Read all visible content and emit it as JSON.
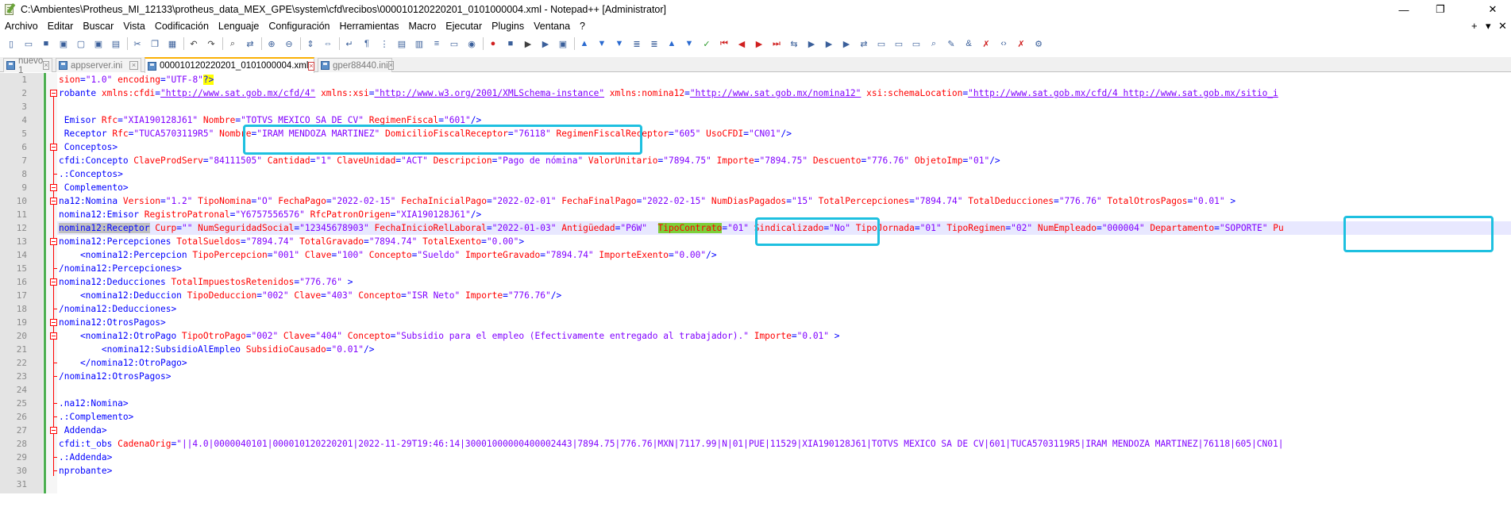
{
  "window": {
    "title": "C:\\Ambientes\\Protheus_MI_12133\\protheus_data_MEX_GPE\\system\\cfd\\recibos\\000010120220201_0101000004.xml - Notepad++ [Administrator]",
    "minimize": "—",
    "restore": "❐",
    "close": "✕"
  },
  "menu": {
    "items": [
      "Archivo",
      "Editar",
      "Buscar",
      "Vista",
      "Codificación",
      "Lenguaje",
      "Configuración",
      "Herramientas",
      "Macro",
      "Ejecutar",
      "Plugins",
      "Ventana",
      "?"
    ],
    "plus": "+",
    "chevron": "▾",
    "close_x": "✕"
  },
  "toolbar": {
    "icons": [
      "new-icon",
      "open-icon",
      "save-icon",
      "save-all-icon",
      "close-icon",
      "close-all-icon",
      "print-icon",
      "cut-icon",
      "copy-icon",
      "paste-icon",
      "undo-icon",
      "redo-icon",
      "find-icon",
      "replace-icon",
      "zoom-in-icon",
      "zoom-out-icon",
      "sync-v-icon",
      "sync-h-icon",
      "wrap-icon",
      "all-chars-icon",
      "indent-guide-icon",
      "udl-icon",
      "doc-map-icon",
      "function-list-icon",
      "folder-workspace-icon",
      "monitor-icon",
      "record-icon",
      "stop-icon",
      "play-icon",
      "run-multiple-icon",
      "save-macro-icon",
      "xml-tools-icon",
      "compare-icon",
      "bookmark-icon",
      "indent-icon",
      "unindent-icon",
      "sort-up-icon",
      "sort-down-icon",
      "check-icon",
      "nav-first-icon",
      "nav-prev-icon",
      "nav-next-icon",
      "nav-last-icon",
      "diff-icon",
      "plugin-a-icon",
      "plugin-b-icon",
      "plugin-c-icon",
      "plugin-d-icon",
      "plugin-e-icon",
      "plugin-f-icon",
      "plugin-g-icon",
      "plugin-h-icon",
      "plugin-i-icon",
      "amp-icon",
      "no-amp-icon",
      "tag-icon",
      "tag-no-icon",
      "settings-icon"
    ]
  },
  "tabs": [
    {
      "label": "nuevo 1",
      "active": false
    },
    {
      "label": "appserver.ini",
      "active": false
    },
    {
      "label": "000010120220201_0101000004.xml",
      "active": true
    },
    {
      "label": "gper88440.ini",
      "active": false
    }
  ],
  "editor": {
    "line_numbers": [
      "1",
      "2",
      "3",
      "4",
      "5",
      "6",
      "7",
      "8",
      "9",
      "10",
      "11",
      "12",
      "13",
      "14",
      "15",
      "16",
      "17",
      "18",
      "19",
      "20",
      "21",
      "22",
      "23",
      "24",
      "25",
      "26",
      "27",
      "28",
      "29",
      "30",
      "31"
    ],
    "current_line": 12,
    "lines": [
      [
        [
          "at",
          "sion"
        ],
        [
          "tg",
          "="
        ],
        [
          "vl",
          "\"1.0\""
        ],
        [
          "at",
          " encoding"
        ],
        [
          "tg",
          "="
        ],
        [
          "vl",
          "\"UTF-8\""
        ],
        [
          "hl",
          "?>"
        ]
      ],
      [
        [
          "tg",
          "robante "
        ],
        [
          "at",
          "xmlns:cfdi"
        ],
        [
          "tg",
          "="
        ],
        [
          "vlu",
          "\"http://www.sat.gob.mx/cfd/4\""
        ],
        [
          "at",
          " xmlns:xsi"
        ],
        [
          "tg",
          "="
        ],
        [
          "vlu",
          "\"http://www.w3.org/2001/XMLSchema-instance\""
        ],
        [
          "at",
          " xmlns:nomina12"
        ],
        [
          "tg",
          "="
        ],
        [
          "vlu",
          "\"http://www.sat.gob.mx/nomina12\""
        ],
        [
          "at",
          " xsi:schemaLocation"
        ],
        [
          "tg",
          "="
        ],
        [
          "vlu",
          "\"http://www.sat.gob.mx/cfd/4 http://www.sat.gob.mx/sitio_i"
        ]
      ],
      [],
      [
        [
          "tg",
          " Emisor "
        ],
        [
          "at",
          "Rfc"
        ],
        [
          "tg",
          "="
        ],
        [
          "vl",
          "\"XIA190128J61\""
        ],
        [
          "at",
          " Nombre"
        ],
        [
          "tg",
          "="
        ],
        [
          "vl",
          "\"TOTVS MEXICO SA DE CV\""
        ],
        [
          "at",
          " RegimenFiscal"
        ],
        [
          "tg",
          "="
        ],
        [
          "vl",
          "\"601\""
        ],
        [
          "tg",
          "/>"
        ]
      ],
      [
        [
          "tg",
          " Receptor "
        ],
        [
          "at",
          "Rfc"
        ],
        [
          "tg",
          "="
        ],
        [
          "vl",
          "\"TUCA5703119R5\""
        ],
        [
          "at",
          " Nombre"
        ],
        [
          "tg",
          "="
        ],
        [
          "vl",
          "\"IRAM MENDOZA MARTINEZ\""
        ],
        [
          "at",
          " DomicilioFiscalReceptor"
        ],
        [
          "tg",
          "="
        ],
        [
          "vl",
          "\"76118\""
        ],
        [
          "at",
          " RegimenFiscalReceptor"
        ],
        [
          "tg",
          "="
        ],
        [
          "vl",
          "\"605\""
        ],
        [
          "at",
          " UsoCFDI"
        ],
        [
          "tg",
          "="
        ],
        [
          "vl",
          "\"CN01\""
        ],
        [
          "tg",
          "/>"
        ]
      ],
      [
        [
          "tg",
          " Conceptos>"
        ]
      ],
      [
        [
          "tg",
          "cfdi:Concepto "
        ],
        [
          "at",
          "ClaveProdServ"
        ],
        [
          "tg",
          "="
        ],
        [
          "vl",
          "\"84111505\""
        ],
        [
          "at",
          " Cantidad"
        ],
        [
          "tg",
          "="
        ],
        [
          "vl",
          "\"1\""
        ],
        [
          "at",
          " ClaveUnidad"
        ],
        [
          "tg",
          "="
        ],
        [
          "vl",
          "\"ACT\""
        ],
        [
          "at",
          " Descripcion"
        ],
        [
          "tg",
          "="
        ],
        [
          "vl",
          "\"Pago de nómina\""
        ],
        [
          "at",
          " ValorUnitario"
        ],
        [
          "tg",
          "="
        ],
        [
          "vl",
          "\"7894.75\""
        ],
        [
          "at",
          " Importe"
        ],
        [
          "tg",
          "="
        ],
        [
          "vl",
          "\"7894.75\""
        ],
        [
          "at",
          " Descuento"
        ],
        [
          "tg",
          "="
        ],
        [
          "vl",
          "\"776.76\""
        ],
        [
          "at",
          " ObjetoImp"
        ],
        [
          "tg",
          "="
        ],
        [
          "vl",
          "\"01\""
        ],
        [
          "tg",
          "/>"
        ]
      ],
      [
        [
          "tg",
          ".:Conceptos>"
        ]
      ],
      [
        [
          "tg",
          " Complemento>"
        ]
      ],
      [
        [
          "tg",
          "na12:Nomina "
        ],
        [
          "at",
          "Version"
        ],
        [
          "tg",
          "="
        ],
        [
          "vl",
          "\"1.2\""
        ],
        [
          "at",
          " TipoNomina"
        ],
        [
          "tg",
          "="
        ],
        [
          "vl",
          "\"O\""
        ],
        [
          "at",
          " FechaPago"
        ],
        [
          "tg",
          "="
        ],
        [
          "vl",
          "\"2022-02-15\""
        ],
        [
          "at",
          " FechaInicialPago"
        ],
        [
          "tg",
          "="
        ],
        [
          "vl",
          "\"2022-02-01\""
        ],
        [
          "at",
          " FechaFinalPago"
        ],
        [
          "tg",
          "="
        ],
        [
          "vl",
          "\"2022-02-15\""
        ],
        [
          "at",
          " NumDiasPagados"
        ],
        [
          "tg",
          "="
        ],
        [
          "vl",
          "\"15\""
        ],
        [
          "at",
          " TotalPercepciones"
        ],
        [
          "tg",
          "="
        ],
        [
          "vl",
          "\"7894.74\""
        ],
        [
          "at",
          " TotalDeducciones"
        ],
        [
          "tg",
          "="
        ],
        [
          "vl",
          "\"776.76\""
        ],
        [
          "at",
          " TotalOtrosPagos"
        ],
        [
          "tg",
          "="
        ],
        [
          "vl",
          "\"0.01\""
        ],
        [
          "tg",
          " >"
        ]
      ],
      [
        [
          "tg",
          "nomina12:Emisor "
        ],
        [
          "at",
          "RegistroPatronal"
        ],
        [
          "tg",
          "="
        ],
        [
          "vl",
          "\"Y6757556576\""
        ],
        [
          "at",
          " RfcPatronOrigen"
        ],
        [
          "tg",
          "="
        ],
        [
          "vl",
          "\"XIA190128J61\""
        ],
        [
          "tg",
          "/>"
        ]
      ],
      [
        [
          "sel",
          "nomina12:Receptor"
        ],
        [
          "at",
          " Curp"
        ],
        [
          "tg",
          "="
        ],
        [
          "vl",
          "\"\""
        ],
        [
          "at",
          " NumSeguridadSocial"
        ],
        [
          "tg",
          "="
        ],
        [
          "vl",
          "\"12345678903\""
        ],
        [
          "at",
          " FechaInicioRelLaboral"
        ],
        [
          "tg",
          "="
        ],
        [
          "vl",
          "\"2022-01-03\""
        ],
        [
          "at",
          " Antigüedad"
        ],
        [
          "tg",
          "="
        ],
        [
          "vl",
          "\"P6W\""
        ],
        [
          "pl",
          "  "
        ],
        [
          "grn",
          "TipoContrato"
        ],
        [
          "tg",
          "="
        ],
        [
          "vl",
          "\"01\""
        ],
        [
          "at",
          " Sindicalizado"
        ],
        [
          "tg",
          "="
        ],
        [
          "vl",
          "\"No\""
        ],
        [
          "at",
          " TipoJornada"
        ],
        [
          "tg",
          "="
        ],
        [
          "vl",
          "\"01\""
        ],
        [
          "at",
          " TipoRegimen"
        ],
        [
          "tg",
          "="
        ],
        [
          "vl",
          "\"02\""
        ],
        [
          "at",
          " NumEmpleado"
        ],
        [
          "tg",
          "="
        ],
        [
          "vl",
          "\"000004\""
        ],
        [
          "at",
          " Departamento"
        ],
        [
          "tg",
          "="
        ],
        [
          "vl",
          "\"SOPORTE\""
        ],
        [
          "at",
          " Pu"
        ]
      ],
      [
        [
          "tg",
          "nomina12:Percepciones "
        ],
        [
          "at",
          "TotalSueldos"
        ],
        [
          "tg",
          "="
        ],
        [
          "vl",
          "\"7894.74\""
        ],
        [
          "at",
          " TotalGravado"
        ],
        [
          "tg",
          "="
        ],
        [
          "vl",
          "\"7894.74\""
        ],
        [
          "at",
          " TotalExento"
        ],
        [
          "tg",
          "="
        ],
        [
          "vl",
          "\"0.00\""
        ],
        [
          "tg",
          ">"
        ]
      ],
      [
        [
          "tg",
          "    <nomina12:Percepcion "
        ],
        [
          "at",
          "TipoPercepcion"
        ],
        [
          "tg",
          "="
        ],
        [
          "vl",
          "\"001\""
        ],
        [
          "at",
          " Clave"
        ],
        [
          "tg",
          "="
        ],
        [
          "vl",
          "\"100\""
        ],
        [
          "at",
          " Concepto"
        ],
        [
          "tg",
          "="
        ],
        [
          "vl",
          "\"Sueldo\""
        ],
        [
          "at",
          " ImporteGravado"
        ],
        [
          "tg",
          "="
        ],
        [
          "vl",
          "\"7894.74\""
        ],
        [
          "at",
          " ImporteExento"
        ],
        [
          "tg",
          "="
        ],
        [
          "vl",
          "\"0.00\""
        ],
        [
          "tg",
          "/>"
        ]
      ],
      [
        [
          "tg",
          "/nomina12:Percepciones>"
        ]
      ],
      [
        [
          "tg",
          "nomina12:Deducciones "
        ],
        [
          "at",
          "TotalImpuestosRetenidos"
        ],
        [
          "tg",
          "="
        ],
        [
          "vl",
          "\"776.76\""
        ],
        [
          "tg",
          " >"
        ]
      ],
      [
        [
          "tg",
          "    <nomina12:Deduccion "
        ],
        [
          "at",
          "TipoDeduccion"
        ],
        [
          "tg",
          "="
        ],
        [
          "vl",
          "\"002\""
        ],
        [
          "at",
          " Clave"
        ],
        [
          "tg",
          "="
        ],
        [
          "vl",
          "\"403\""
        ],
        [
          "at",
          " Concepto"
        ],
        [
          "tg",
          "="
        ],
        [
          "vl",
          "\"ISR Neto\""
        ],
        [
          "at",
          " Importe"
        ],
        [
          "tg",
          "="
        ],
        [
          "vl",
          "\"776.76\""
        ],
        [
          "tg",
          "/>"
        ]
      ],
      [
        [
          "tg",
          "/nomina12:Deducciones>"
        ]
      ],
      [
        [
          "tg",
          "nomina12:OtrosPagos>"
        ]
      ],
      [
        [
          "tg",
          "    <nomina12:OtroPago "
        ],
        [
          "at",
          "TipoOtroPago"
        ],
        [
          "tg",
          "="
        ],
        [
          "vl",
          "\"002\""
        ],
        [
          "at",
          " Clave"
        ],
        [
          "tg",
          "="
        ],
        [
          "vl",
          "\"404\""
        ],
        [
          "at",
          " Concepto"
        ],
        [
          "tg",
          "="
        ],
        [
          "vl",
          "\"Subsidio para el empleo (Efectivamente entregado al trabajador).\""
        ],
        [
          "at",
          " Importe"
        ],
        [
          "tg",
          "="
        ],
        [
          "vl",
          "\"0.01\""
        ],
        [
          "tg",
          " >"
        ]
      ],
      [
        [
          "tg",
          "        <nomina12:SubsidioAlEmpleo "
        ],
        [
          "at",
          "SubsidioCausado"
        ],
        [
          "tg",
          "="
        ],
        [
          "vl",
          "\"0.01\""
        ],
        [
          "tg",
          "/>"
        ]
      ],
      [
        [
          "tg",
          "    </nomina12:OtroPago>"
        ]
      ],
      [
        [
          "tg",
          "/nomina12:OtrosPagos>"
        ]
      ],
      [],
      [
        [
          "tg",
          ".na12:Nomina>"
        ]
      ],
      [
        [
          "tg",
          ".:Complemento>"
        ]
      ],
      [
        [
          "tg",
          " Addenda>"
        ]
      ],
      [
        [
          "tg",
          "cfdi:t_obs "
        ],
        [
          "at",
          "CadenaOrig"
        ],
        [
          "tg",
          "="
        ],
        [
          "vl",
          "\"||4.0|0000040101|000010120220201|2022-11-29T19:46:14|30001000000400002443|7894.75|776.76|MXN|7117.99|N|01|PUE|11529|XIA190128J61|TOTVS MEXICO SA DE CV|601|TUCA5703119R5|IRAM MENDOZA MARTINEZ|76118|605|CN01|"
        ]
      ],
      [
        [
          "tg",
          ".:Addenda>"
        ]
      ],
      [
        [
          "tg",
          "nprobante>"
        ]
      ],
      []
    ]
  }
}
